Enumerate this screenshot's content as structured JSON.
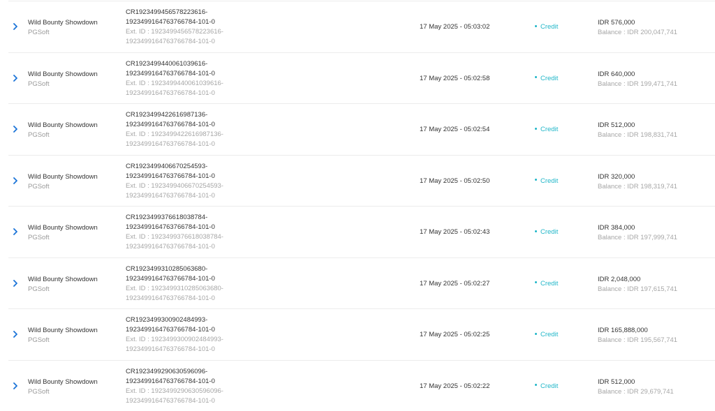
{
  "accent_color": "#1fb6c8",
  "rows": [
    {
      "game": "Wild Bounty Showdown",
      "provider": "PGSoft",
      "id_line1": "CR1923499456578223616-",
      "id_line2": "1923499164763766784-101-0",
      "ext_line1": "Ext. ID : 1923499456578223616-",
      "ext_line2": "1923499164763766784-101-0",
      "datetime": "17 May 2025 - 05:03:02",
      "type": "Credit",
      "amount": "IDR 576,000",
      "balance": "Balance : IDR 200,047,741"
    },
    {
      "game": "Wild Bounty Showdown",
      "provider": "PGSoft",
      "id_line1": "CR1923499440061039616-",
      "id_line2": "1923499164763766784-101-0",
      "ext_line1": "Ext. ID : 1923499440061039616-",
      "ext_line2": "1923499164763766784-101-0",
      "datetime": "17 May 2025 - 05:02:58",
      "type": "Credit",
      "amount": "IDR 640,000",
      "balance": "Balance : IDR 199,471,741"
    },
    {
      "game": "Wild Bounty Showdown",
      "provider": "PGSoft",
      "id_line1": "CR1923499422616987136-",
      "id_line2": "1923499164763766784-101-0",
      "ext_line1": "Ext. ID : 1923499422616987136-",
      "ext_line2": "1923499164763766784-101-0",
      "datetime": "17 May 2025 - 05:02:54",
      "type": "Credit",
      "amount": "IDR 512,000",
      "balance": "Balance : IDR 198,831,741"
    },
    {
      "game": "Wild Bounty Showdown",
      "provider": "PGSoft",
      "id_line1": "CR1923499406670254593-",
      "id_line2": "1923499164763766784-101-0",
      "ext_line1": "Ext. ID : 1923499406670254593-",
      "ext_line2": "1923499164763766784-101-0",
      "datetime": "17 May 2025 - 05:02:50",
      "type": "Credit",
      "amount": "IDR 320,000",
      "balance": "Balance : IDR 198,319,741"
    },
    {
      "game": "Wild Bounty Showdown",
      "provider": "PGSoft",
      "id_line1": "CR1923499376618038784-",
      "id_line2": "1923499164763766784-101-0",
      "ext_line1": "Ext. ID : 1923499376618038784-",
      "ext_line2": "1923499164763766784-101-0",
      "datetime": "17 May 2025 - 05:02:43",
      "type": "Credit",
      "amount": "IDR 384,000",
      "balance": "Balance : IDR 197,999,741"
    },
    {
      "game": "Wild Bounty Showdown",
      "provider": "PGSoft",
      "id_line1": "CR1923499310285063680-",
      "id_line2": "1923499164763766784-101-0",
      "ext_line1": "Ext. ID : 1923499310285063680-",
      "ext_line2": "1923499164763766784-101-0",
      "datetime": "17 May 2025 - 05:02:27",
      "type": "Credit",
      "amount": "IDR 2,048,000",
      "balance": "Balance : IDR 197,615,741"
    },
    {
      "game": "Wild Bounty Showdown",
      "provider": "PGSoft",
      "id_line1": "CR1923499300902484993-",
      "id_line2": "1923499164763766784-101-0",
      "ext_line1": "Ext. ID : 1923499300902484993-",
      "ext_line2": "1923499164763766784-101-0",
      "datetime": "17 May 2025 - 05:02:25",
      "type": "Credit",
      "amount": "IDR 165,888,000",
      "balance": "Balance : IDR 195,567,741"
    },
    {
      "game": "Wild Bounty Showdown",
      "provider": "PGSoft",
      "id_line1": "CR1923499290630596096-",
      "id_line2": "1923499164763766784-101-0",
      "ext_line1": "Ext. ID : 1923499290630596096-",
      "ext_line2": "1923499164763766784-101-0",
      "datetime": "17 May 2025 - 05:02:22",
      "type": "Credit",
      "amount": "IDR 512,000",
      "balance": "Balance : IDR 29,679,741"
    }
  ]
}
